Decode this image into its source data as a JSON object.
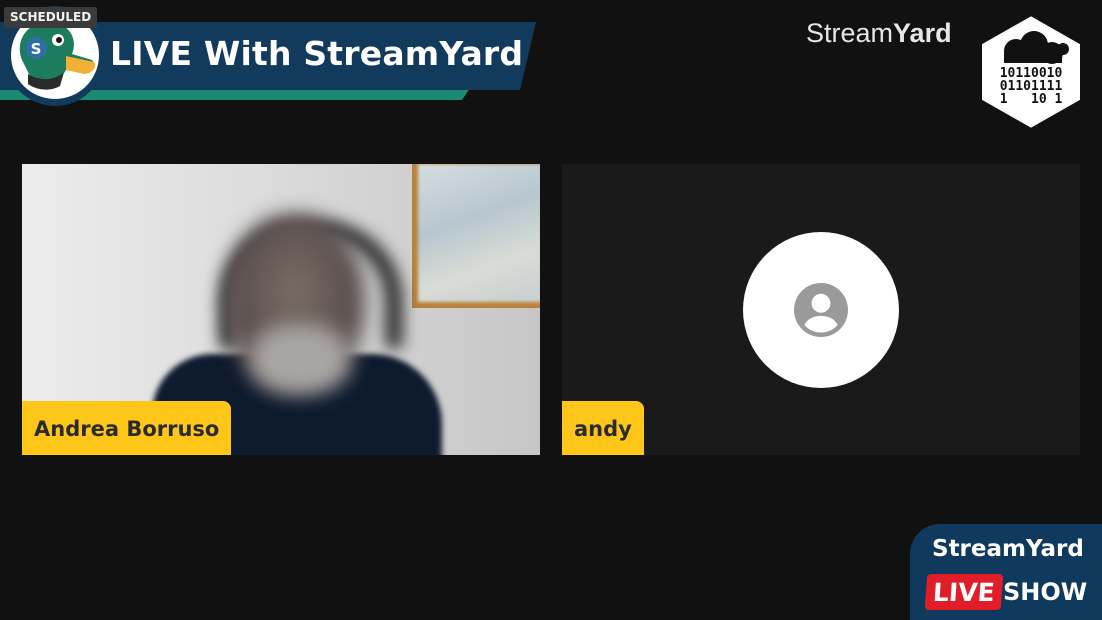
{
  "status_badge": "SCHEDULED",
  "banner": {
    "title": "LIVE With StreamYard"
  },
  "brand": {
    "word_light": "Stream",
    "word_bold": "Yard"
  },
  "hex_logo": {
    "lines": [
      "10110010",
      "01101111",
      "1   10 1"
    ]
  },
  "participants": [
    {
      "name": "Andrea Borruso",
      "video": true
    },
    {
      "name": "andy",
      "video": false,
      "avatar_icon": "user-avatar-icon"
    }
  ],
  "show_badge": {
    "title": "StreamYard",
    "live": "LIVE",
    "show": "SHOW"
  },
  "colors": {
    "background": "#111111",
    "banner_blue": "#123a5c",
    "banner_teal": "#1b8a72",
    "name_tag": "#ffc61a",
    "live_red": "#e21d2a"
  }
}
